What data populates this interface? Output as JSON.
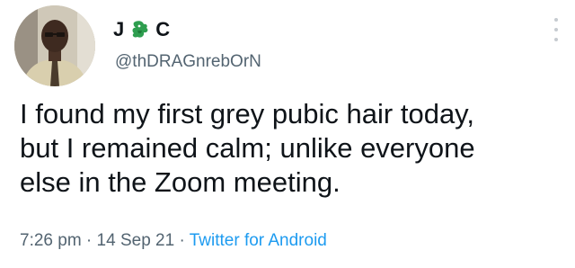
{
  "author": {
    "name_start": "J",
    "name_emoji": "dragon-icon",
    "name_end": "C",
    "handle": "@thDRAGnrebOrN"
  },
  "tweet": {
    "text_lines": [
      "I found my first grey pubic hair today,",
      "but I remained calm; unlike everyone",
      "else in the Zoom meeting."
    ],
    "time": "7:26 pm",
    "sep1": " · ",
    "date": "14 Sep 21",
    "sep2": " · ",
    "source": "Twitter for Android"
  },
  "colors": {
    "text": "#0f1419",
    "secondary": "#536471",
    "link": "#1d9bf0",
    "dragon": "#2e9e4f"
  },
  "icons": {
    "more": "more-options-icon",
    "avatar": "avatar"
  }
}
